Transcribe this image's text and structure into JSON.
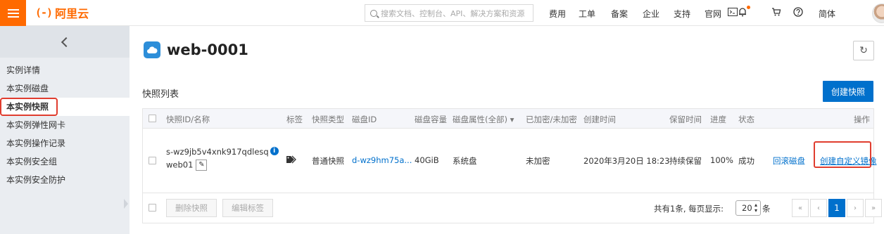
{
  "topbar": {
    "logo_mark": "(-)",
    "logo_text": "阿里云",
    "search_placeholder": "搜索文档、控制台、API、解决方案和资源",
    "nav": [
      "费用",
      "工单",
      "备案",
      "企业",
      "支持",
      "官网"
    ],
    "lang": "简体",
    "icons": [
      "terminal-icon",
      "bell-icon",
      "cart-icon",
      "help-icon"
    ],
    "brand_color": "#ff6a00"
  },
  "sidebar": {
    "items": [
      {
        "label": "实例详情",
        "active": false
      },
      {
        "label": "本实例磁盘",
        "active": false
      },
      {
        "label": "本实例快照",
        "active": true
      },
      {
        "label": "本实例弹性网卡",
        "active": false
      },
      {
        "label": "本实例操作记录",
        "active": false
      },
      {
        "label": "本实例安全组",
        "active": false
      },
      {
        "label": "本实例安全防护",
        "active": false
      }
    ]
  },
  "main": {
    "title": "web-0001",
    "section_title": "快照列表",
    "create_button": "创建快照",
    "table": {
      "headers": [
        "快照ID/名称",
        "标签",
        "快照类型",
        "磁盘ID",
        "磁盘容量",
        "磁盘属性(全部)",
        "已加密/未加密",
        "创建时间",
        "保留时间",
        "进度",
        "状态",
        "操作"
      ],
      "rows": [
        {
          "snapshot_id": "s-wz9jb5v4xnk917qdlesq",
          "name": "web01",
          "type": "普通快照",
          "disk_id": "d-wz9hm75a...",
          "capacity": "40GiB",
          "disk_attr": "系统盘",
          "encrypted": "未加密",
          "created": "2020年3月20日 18:23",
          "retention": "持续保留",
          "progress": "100%",
          "status": "成功",
          "action_rollback": "回滚磁盘",
          "action_create_image": "创建自定义镜像"
        }
      ]
    },
    "footer": {
      "delete_button": "删除快照",
      "edit_tags_button": "编辑标签",
      "total_text": "共有1条, 每页显示:",
      "page_size": "20",
      "page_size_unit": "条",
      "current_page": "1"
    }
  },
  "colors": {
    "primary": "#0070cc",
    "highlight": "#e03d2f"
  }
}
